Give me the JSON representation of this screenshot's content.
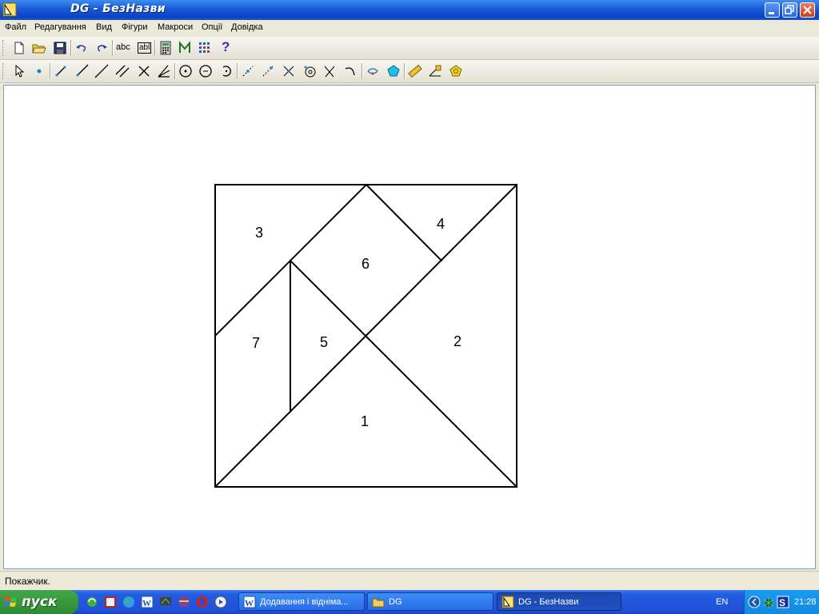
{
  "window": {
    "title": "DG - БезНазви"
  },
  "menu": [
    "Файл",
    "Редагування",
    "Вид",
    "Фігури",
    "Макроси",
    "Опції",
    "Довідка"
  ],
  "toolbar1": {
    "items": [
      "new-file-icon",
      "open-folder-icon",
      "save-icon",
      "undo-icon",
      "redo-icon",
      "text-label-icon",
      "text-field-icon",
      "calculator-icon",
      "macro-icon",
      "grid-icon",
      "help-icon"
    ],
    "text_tool": "abc",
    "field_tool": "abl",
    "help_glyph": "?"
  },
  "toolbar2": {
    "items": [
      "pointer-icon",
      "point-icon",
      "segment-icon",
      "ray-icon",
      "line-icon",
      "parallel-icon",
      "perpendicular-icon",
      "angle-bisector-icon",
      "circle-center-icon",
      "circle-radius-icon",
      "arc-icon",
      "midpoint-icon",
      "point-on-object-icon",
      "intersection-icon",
      "point-on-circle-icon",
      "reflection-icon",
      "rotation-icon",
      "locus-icon",
      "polygon-icon",
      "measure-icon",
      "calculate-icon",
      "transform-icon"
    ]
  },
  "drawing": {
    "pieces": [
      {
        "id": "piece-1",
        "label": "1"
      },
      {
        "id": "piece-2",
        "label": "2"
      },
      {
        "id": "piece-3",
        "label": "3"
      },
      {
        "id": "piece-4",
        "label": "4"
      },
      {
        "id": "piece-5",
        "label": "5"
      },
      {
        "id": "piece-6",
        "label": "6"
      },
      {
        "id": "piece-7",
        "label": "7"
      }
    ]
  },
  "status": {
    "text": "Покажчик."
  },
  "taskbar": {
    "start_label": "пуск",
    "tasks": [
      {
        "label": "Додавання і відніма...",
        "active": false
      },
      {
        "label": "DG",
        "active": false
      },
      {
        "label": "DG - БезНазви",
        "active": true
      }
    ],
    "language": "EN",
    "clock": "21:28"
  },
  "colors": {
    "titlebar": "#0a44c6",
    "taskbar": "#245de0",
    "start": "#3a9b3e",
    "tray": "#118ae0"
  }
}
